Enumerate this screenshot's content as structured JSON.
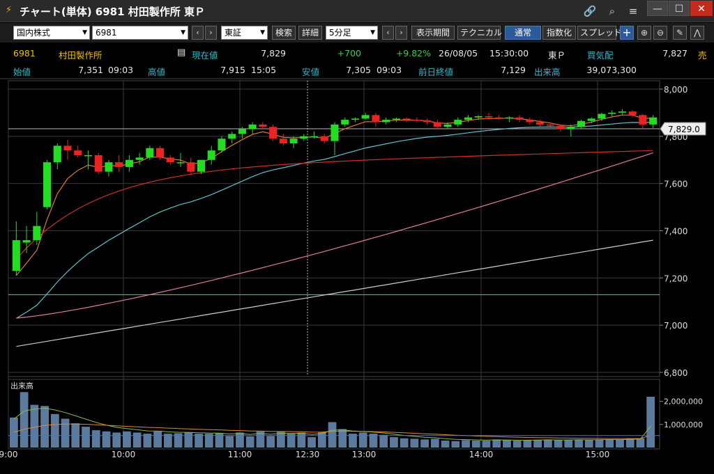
{
  "window": {
    "title": "チャート(単体) 6981 村田製作所 東Ｐ",
    "minimize": "—",
    "maximize": "☐",
    "close": "✕"
  },
  "toolbar": {
    "market_select": "国内株式",
    "code_input": "6981",
    "exchange_select": "東証",
    "search_label": "検索",
    "detail_label": "詳細",
    "interval_select": "5分足",
    "period_label": "表示期間",
    "technical_label": "テクニカル",
    "normal_label": "通常",
    "index_label": "指数化",
    "spread_label": "スプレッド",
    "crosshair_label": "+"
  },
  "quote": {
    "code": "6981",
    "name": "村田製作所",
    "current_label": "現在値",
    "current_value": "7,829",
    "change": "+700",
    "change_pct": "+9.82%",
    "date": "26/08/05",
    "time": "15:30:00",
    "market": "東Ｐ",
    "bid_ask_label": "買気配",
    "bid_value": "7,827",
    "ask_label": "売",
    "open_label": "始値",
    "open_value": "7,351",
    "open_time": "09:03",
    "high_label": "高値",
    "high_value": "7,915",
    "high_time": "15:05",
    "low_label": "安値",
    "low_value": "7,305",
    "low_time": "09:03",
    "prev_close_label": "前日終値",
    "prev_close_value": "7,129",
    "volume_label": "出来高",
    "volume_value": "39,073,300"
  },
  "chart_data": {
    "type": "candlestick",
    "ylim": [
      6800,
      8000
    ],
    "y_ticks": [
      "8,000",
      "7,800",
      "7,600",
      "7,400",
      "7,200",
      "7,000",
      "6,800"
    ],
    "x_ticks": [
      "9:00",
      "10:00",
      "11:00",
      "12:30",
      "13:00",
      "14:00",
      "15:00"
    ],
    "current_price_label": "7,829.0",
    "current_price": 7829,
    "horizontal_line": 7129,
    "volume_label": "出来高",
    "volume_ticks": [
      "2,000,000",
      "1,000,000"
    ],
    "volume_ylim": [
      0,
      2500000
    ],
    "candles": [
      [
        7230,
        7440,
        7210,
        7360
      ],
      [
        7350,
        7420,
        7305,
        7360
      ],
      [
        7360,
        7480,
        7340,
        7420
      ],
      [
        7500,
        7700,
        7490,
        7690
      ],
      [
        7690,
        7770,
        7660,
        7760
      ],
      [
        7760,
        7785,
        7700,
        7740
      ],
      [
        7740,
        7760,
        7710,
        7720
      ],
      [
        7720,
        7740,
        7660,
        7720
      ],
      [
        7720,
        7730,
        7640,
        7650
      ],
      [
        7650,
        7700,
        7630,
        7690
      ],
      [
        7690,
        7720,
        7650,
        7670
      ],
      [
        7670,
        7720,
        7650,
        7700
      ],
      [
        7700,
        7730,
        7680,
        7710
      ],
      [
        7710,
        7760,
        7700,
        7750
      ],
      [
        7750,
        7760,
        7700,
        7710
      ],
      [
        7710,
        7720,
        7680,
        7690
      ],
      [
        7690,
        7730,
        7670,
        7690
      ],
      [
        7690,
        7710,
        7640,
        7650
      ],
      [
        7650,
        7700,
        7640,
        7700
      ],
      [
        7700,
        7760,
        7680,
        7740
      ],
      [
        7740,
        7800,
        7730,
        7790
      ],
      [
        7790,
        7820,
        7770,
        7810
      ],
      [
        7810,
        7840,
        7790,
        7830
      ],
      [
        7830,
        7860,
        7810,
        7850
      ],
      [
        7850,
        7860,
        7830,
        7840
      ],
      [
        7840,
        7850,
        7780,
        7790
      ],
      [
        7790,
        7810,
        7760,
        7770
      ],
      [
        7770,
        7800,
        7750,
        7790
      ],
      [
        7790,
        7810,
        7780,
        7800
      ],
      [
        7800,
        7820,
        7790,
        7800
      ],
      [
        7800,
        7810,
        7770,
        7780
      ],
      [
        7780,
        7860,
        7720,
        7850
      ],
      [
        7850,
        7880,
        7840,
        7870
      ],
      [
        7870,
        7880,
        7860,
        7875
      ],
      [
        7875,
        7900,
        7870,
        7890
      ],
      [
        7890,
        7900,
        7840,
        7860
      ],
      [
        7860,
        7880,
        7850,
        7870
      ],
      [
        7870,
        7880,
        7860,
        7875
      ],
      [
        7875,
        7880,
        7860,
        7870
      ],
      [
        7870,
        7880,
        7860,
        7868
      ],
      [
        7868,
        7875,
        7850,
        7860
      ],
      [
        7860,
        7870,
        7830,
        7840
      ],
      [
        7840,
        7860,
        7830,
        7850
      ],
      [
        7850,
        7880,
        7840,
        7870
      ],
      [
        7870,
        7890,
        7860,
        7880
      ],
      [
        7880,
        7890,
        7870,
        7885
      ],
      [
        7885,
        7900,
        7870,
        7880
      ],
      [
        7880,
        7890,
        7870,
        7875
      ],
      [
        7875,
        7885,
        7860,
        7880
      ],
      [
        7880,
        7890,
        7860,
        7870
      ],
      [
        7870,
        7880,
        7850,
        7860
      ],
      [
        7860,
        7870,
        7840,
        7850
      ],
      [
        7850,
        7860,
        7840,
        7845
      ],
      [
        7845,
        7850,
        7820,
        7830
      ],
      [
        7830,
        7850,
        7800,
        7840
      ],
      [
        7840,
        7870,
        7830,
        7865
      ],
      [
        7865,
        7880,
        7855,
        7875
      ],
      [
        7875,
        7900,
        7865,
        7895
      ],
      [
        7895,
        7910,
        7885,
        7900
      ],
      [
        7900,
        7915,
        7890,
        7905
      ],
      [
        7905,
        7910,
        7880,
        7890
      ],
      [
        7890,
        7895,
        7830,
        7850
      ],
      [
        7850,
        7890,
        7835,
        7880
      ]
    ],
    "volume": [
      1300000,
      2400000,
      1850000,
      1800000,
      1450000,
      1250000,
      1050000,
      900000,
      750000,
      700000,
      650000,
      700000,
      650000,
      600000,
      700000,
      600000,
      620000,
      650000,
      600000,
      600000,
      620000,
      500000,
      650000,
      480000,
      700000,
      500000,
      700000,
      600000,
      650000,
      450000,
      680000,
      1100000,
      800000,
      600000,
      650000,
      600000,
      550000,
      450000,
      400000,
      380000,
      350000,
      380000,
      300000,
      280000,
      320000,
      300000,
      300000,
      350000,
      320000,
      300000,
      320000,
      340000,
      350000,
      320000,
      340000,
      350000,
      330000,
      350000,
      360000,
      340000,
      380000,
      400000,
      2200000
    ],
    "ma_short_color": "#e07a2a",
    "ma_mid_color": "#5ec4cf",
    "ma_long_color": "#d0302a",
    "ma_pink_color": "#e07ab0",
    "ma_white_color": "#cccccc",
    "hline_color": "#5cd65c",
    "up_color": "#22dd22",
    "down_color": "#ee2222"
  }
}
